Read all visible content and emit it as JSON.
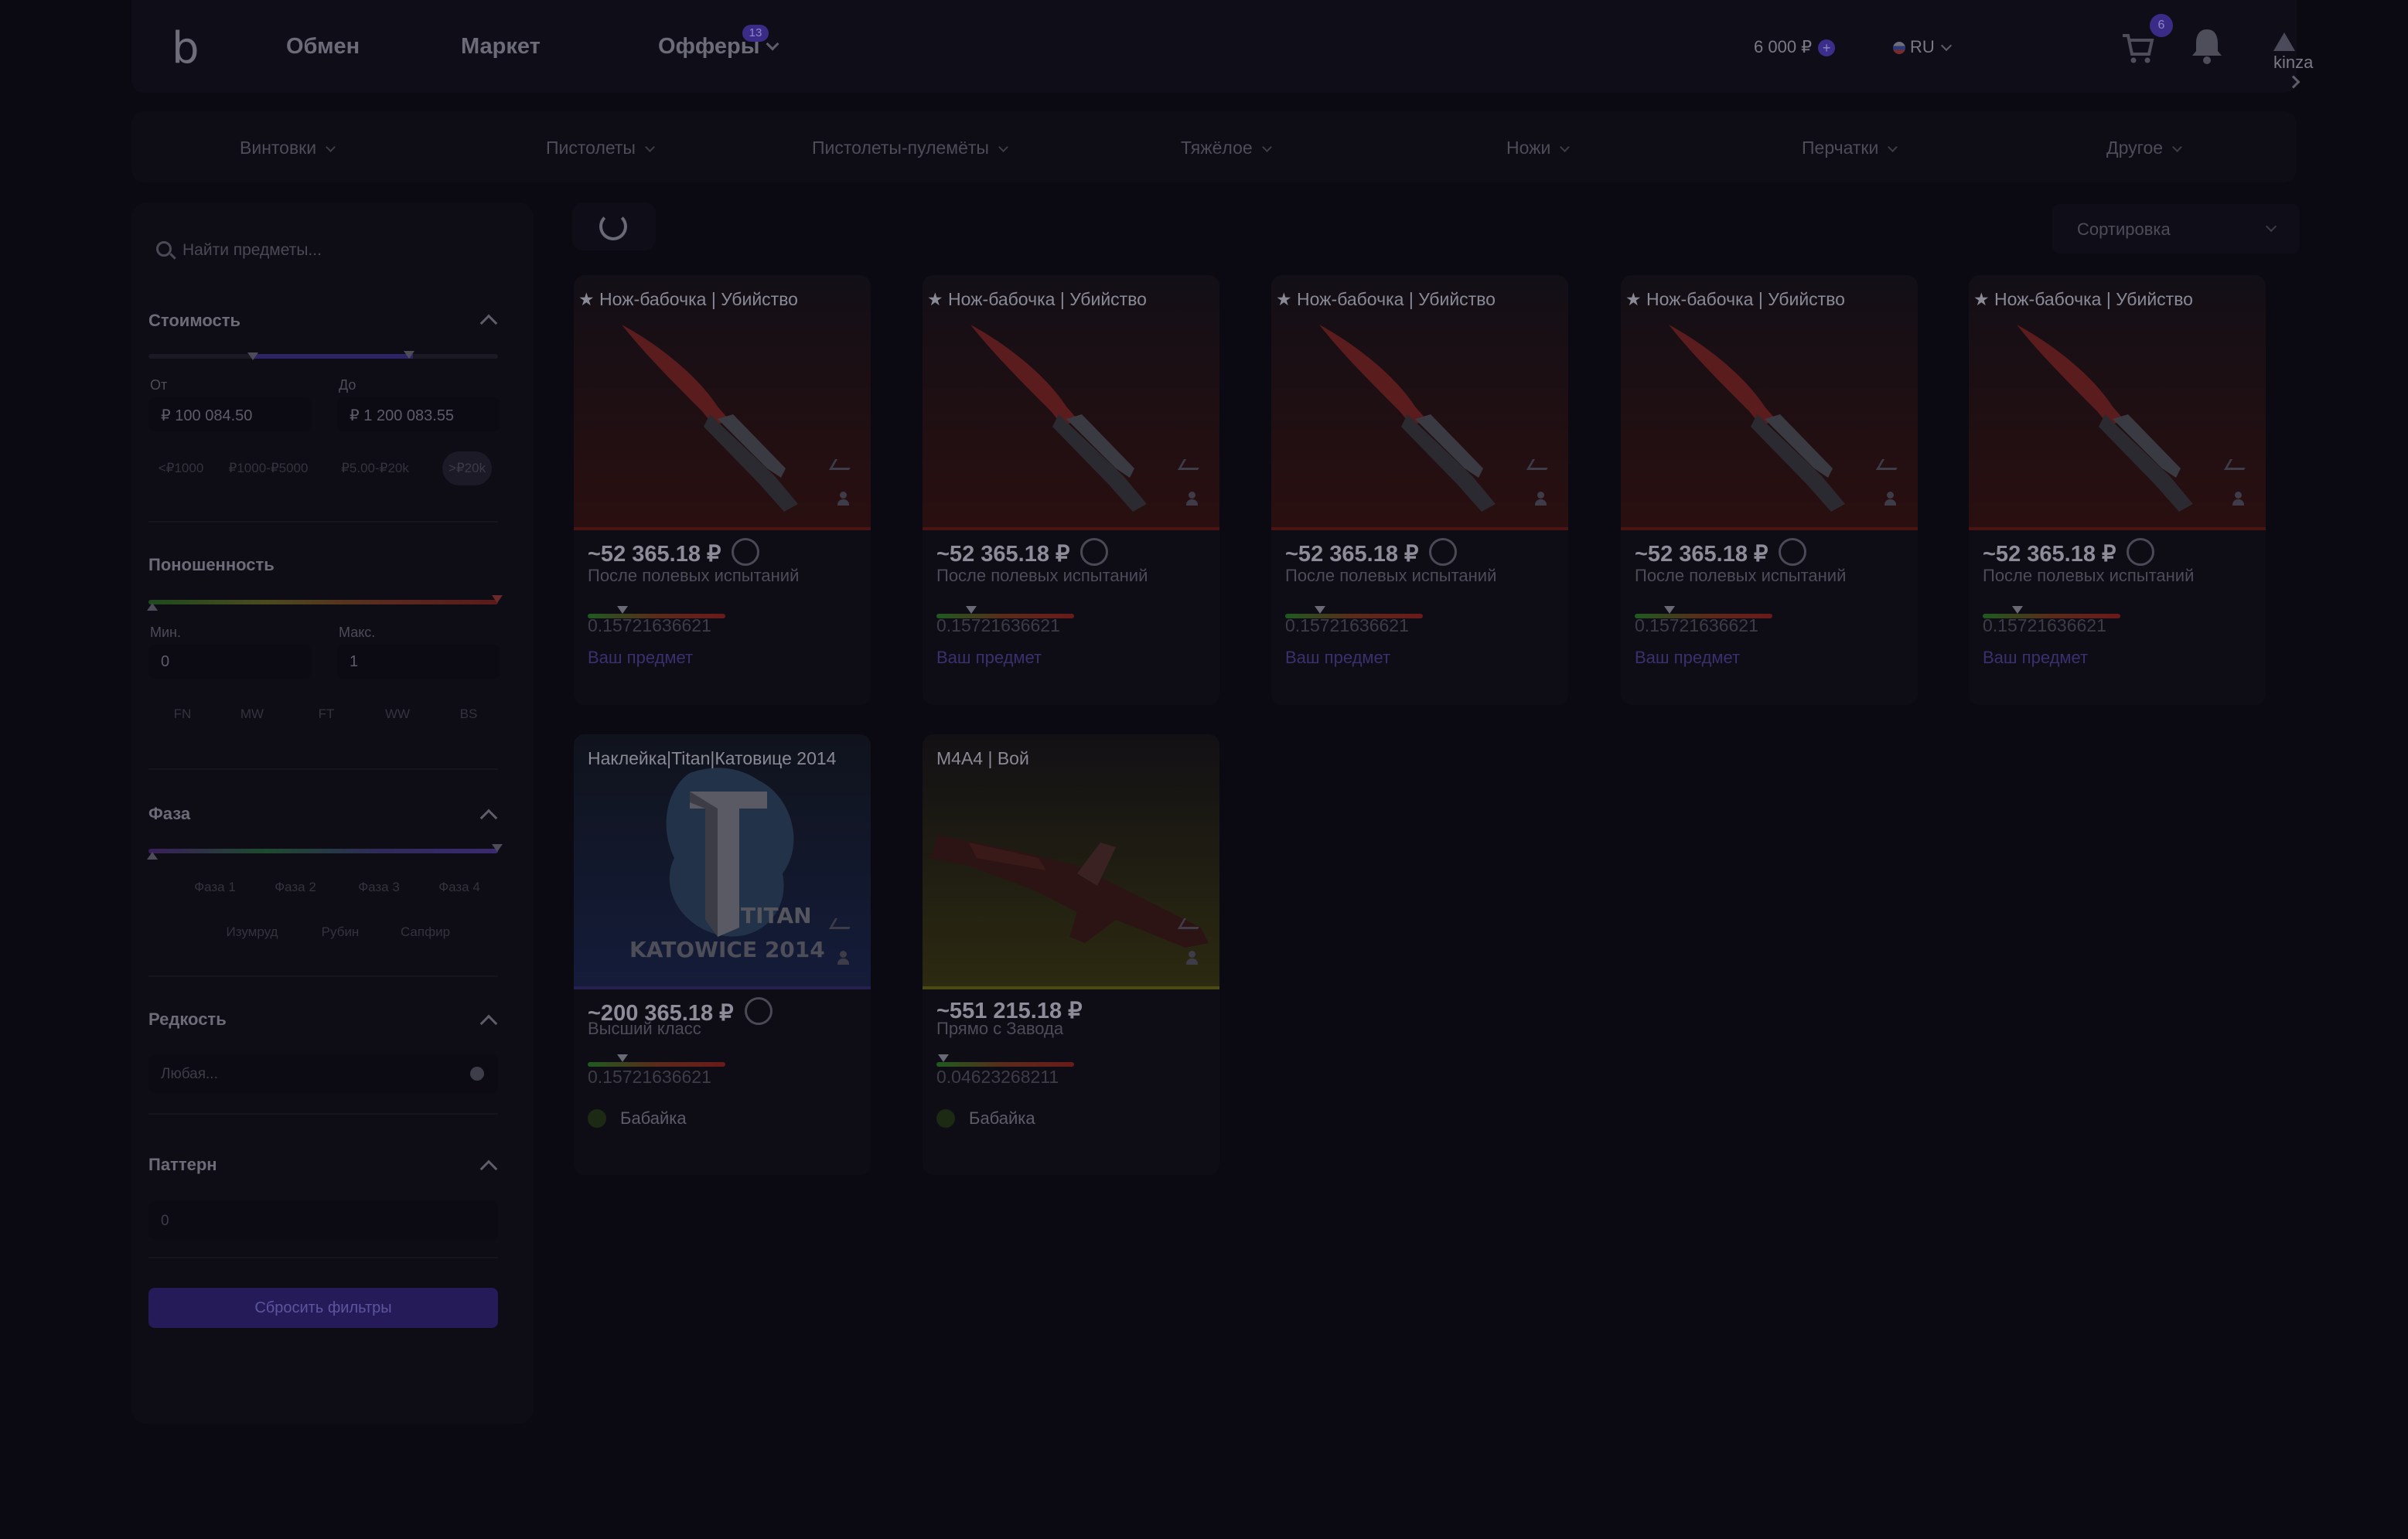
{
  "header": {
    "logo": "b",
    "nav": [
      "Обмен",
      "Маркет",
      "Офферы"
    ],
    "offers_badge": "13",
    "balance": "6 000 ₽",
    "balance_plus": "+",
    "language": "RU",
    "cart_count": "6",
    "username": "kinza"
  },
  "categories": [
    "Винтовки",
    "Пистолеты",
    "Пистолеты-пулемёты",
    "Тяжёлое",
    "Ножи",
    "Перчатки",
    "Другое"
  ],
  "sidebar": {
    "search_placeholder": "Найти предметы...",
    "price": {
      "title": "Стоимость",
      "from_label": "От",
      "to_label": "До",
      "from_value": "₽ 100 084.50",
      "to_value": "₽ 1 200 083.55",
      "chips": [
        "<₽1000",
        "₽1000-₽5000",
        "₽5.00-₽20k",
        ">₽20k"
      ],
      "active_chip": 3
    },
    "wear": {
      "title": "Поношенность",
      "min_label": "Мин.",
      "max_label": "Макс.",
      "min_value": "0",
      "max_value": "1",
      "chips": [
        "FN",
        "MW",
        "FT",
        "WW",
        "BS"
      ]
    },
    "phase": {
      "title": "Фаза",
      "chips_row1": [
        "Фаза 1",
        "Фаза 2",
        "Фаза 3",
        "Фаза 4"
      ],
      "chips_row2": [
        "Изумруд",
        "Рубин",
        "Сапфир"
      ]
    },
    "rarity": {
      "title": "Редкость",
      "placeholder": "Любая..."
    },
    "pattern": {
      "title": "Паттерн",
      "value": "0"
    },
    "reset_label": "Сбросить фильтры"
  },
  "toolbar": {
    "sort_label": "Сортировка"
  },
  "items": [
    {
      "title": "★ Нож-бабочка | Убийство",
      "price": "~52 365.18 ₽",
      "wear": "После полевых испытаний",
      "float": "0.15721636621",
      "wear_fraction": 0.25,
      "footer": "Ваш предмет",
      "footer_type": "own",
      "kind": "knife"
    },
    {
      "title": "★ Нож-бабочка | Убийство",
      "price": "~52 365.18 ₽",
      "wear": "После полевых испытаний",
      "float": "0.15721636621",
      "wear_fraction": 0.25,
      "footer": "Ваш предмет",
      "footer_type": "own",
      "kind": "knife"
    },
    {
      "title": "★ Нож-бабочка | Убийство",
      "price": "~52 365.18 ₽",
      "wear": "После полевых испытаний",
      "float": "0.15721636621",
      "wear_fraction": 0.25,
      "footer": "Ваш предмет",
      "footer_type": "own",
      "kind": "knife"
    },
    {
      "title": "★ Нож-бабочка | Убийство",
      "price": "~52 365.18 ₽",
      "wear": "После полевых испытаний",
      "float": "0.15721636621",
      "wear_fraction": 0.25,
      "footer": "Ваш предмет",
      "footer_type": "own",
      "kind": "knife"
    },
    {
      "title": "★ Нож-бабочка | Убийство",
      "price": "~52 365.18 ₽",
      "wear": "После полевых испытаний",
      "float": "0.15721636621",
      "wear_fraction": 0.25,
      "footer": "Ваш предмет",
      "footer_type": "own",
      "kind": "knife"
    },
    {
      "title": "Наклейка|Titan|Катовице 2014",
      "price": "~200 365.18 ₽",
      "wear": "Высший класс",
      "float": "0.15721636621",
      "wear_fraction": 0.25,
      "footer": "Бабайка",
      "footer_type": "seller",
      "kind": "sticker",
      "sticker_text_1": "TITAN",
      "sticker_text_2": "KATOWICE 2014"
    },
    {
      "title": "M4A4 | Вой",
      "price": "~551 215.18 ₽",
      "wear": "Прямо с Завода",
      "float": "0.04623268211",
      "wear_fraction": 0.05,
      "footer": "Бабайка",
      "footer_type": "seller",
      "kind": "rifle"
    }
  ]
}
